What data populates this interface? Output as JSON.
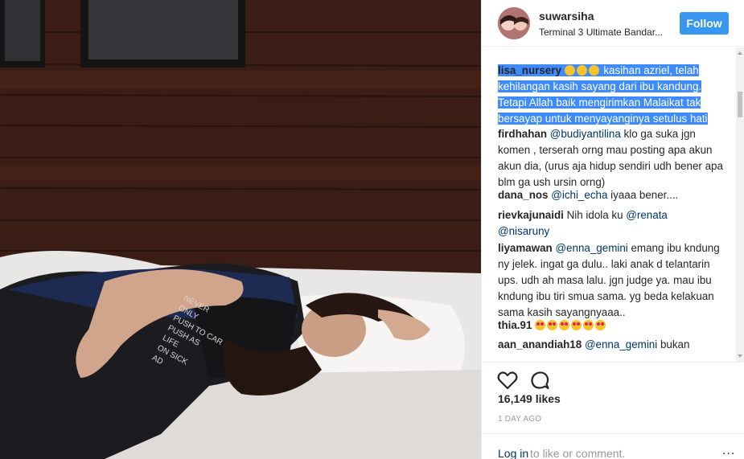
{
  "post": {
    "username": "suwarsiha",
    "location": "Terminal 3 Ultimate Bandar...",
    "follow_label": "Follow",
    "shirt_text": [
      "NEVER",
      "ONLY",
      "PUSH TO CAR",
      "PUSH AS",
      "LIFE",
      "ON SICK",
      "AD"
    ]
  },
  "comments": [
    {
      "user": "lisa_nursery",
      "emojis": [
        "sad",
        "sad",
        "sad"
      ],
      "text_parts": [
        " kasihan azriel, telah",
        "kehilangan kasih sayang dari ibu kandung.",
        "Tetapi Allah baik mengirimkan Malaikat tak",
        "bersayap untuk menyayanginya setulus hati"
      ],
      "selected": true
    },
    {
      "user": "firdhahan",
      "mention": "@budiyantilina",
      "text": " klo ga suka jgn komen , terserah orng mau posting apa akun akun dia, (urus aja hidup sendiri udh bener apa blm ga ush ursin orng)"
    },
    {
      "user": "dana_nos",
      "mention": "@ichi_echa",
      "text": " iyaaa bener...."
    },
    {
      "user": "rievkajunaidi",
      "text": " Nih idola ku ",
      "mention": "@renata",
      "mention2": "@nisaruny"
    },
    {
      "user": "liyamawan",
      "mention": "@enna_gemini",
      "text": " emang ibu kndung ny jelek. ingat ga dulu.. laki anak d telantarin ups. udh ah masa lalu. jgn judge ya. mau ibu kndung ibu tiri smua sama. yg beda kelakuan sama kasih sayangnyaaa.."
    },
    {
      "user": "thia.91",
      "emojis": [
        "love",
        "love",
        "love",
        "love",
        "love",
        "love"
      ]
    },
    {
      "user": "aan_anandiah18",
      "mention": "@enna_gemini",
      "text": " bukan"
    }
  ],
  "actions": {
    "like_icon": "heart-icon",
    "comment_icon": "comment-icon",
    "likes_text": "16,149 likes",
    "time_text": "1 DAY AGO",
    "login_link": "Log in",
    "login_rest": " to like or comment.",
    "more_icon": "..."
  }
}
